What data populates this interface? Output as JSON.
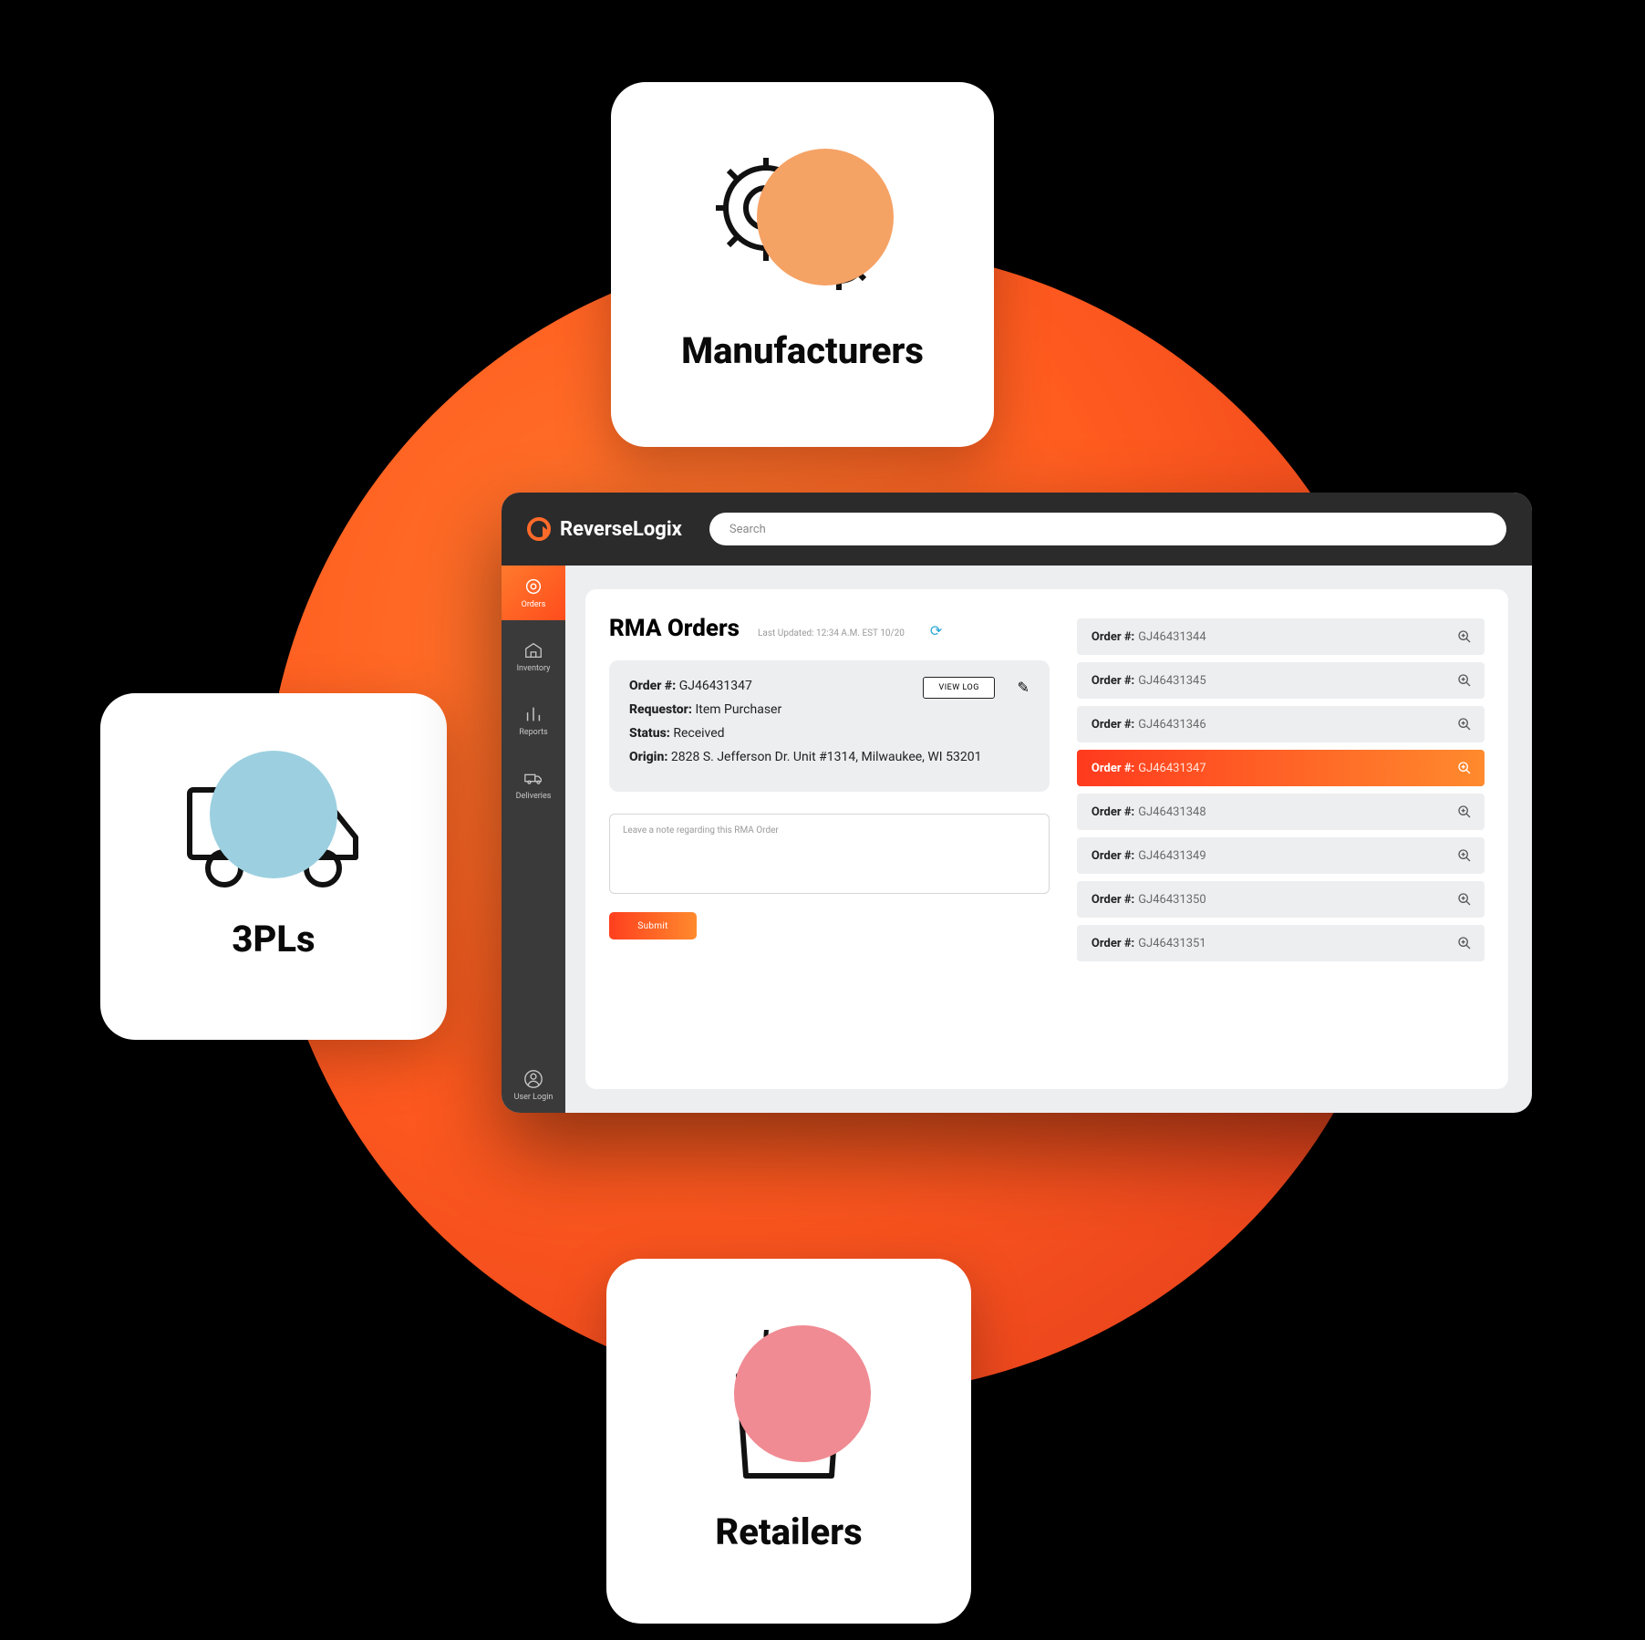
{
  "cards": {
    "top": {
      "label": "Manufacturers"
    },
    "left": {
      "label": "3PLs"
    },
    "bottom": {
      "label": "Retailers"
    }
  },
  "app": {
    "brand": "ReverseLogix",
    "search_placeholder": "Search",
    "sidebar": [
      {
        "key": "orders",
        "label": "Orders",
        "active": true
      },
      {
        "key": "inventory",
        "label": "Inventory"
      },
      {
        "key": "reports",
        "label": "Reports"
      },
      {
        "key": "deliveries",
        "label": "Deliveries"
      }
    ],
    "user_login": "User Login",
    "page": {
      "title": "RMA Orders",
      "last_updated": "Last Updated: 12:34 A.M. EST 10/20",
      "detail": {
        "order_label": "Order #:",
        "order": "GJ46431347",
        "requestor_label": "Requestor:",
        "requestor": "Item Purchaser",
        "status_label": "Status:",
        "status": "Received",
        "origin_label": "Origin:",
        "origin": "2828 S. Jefferson Dr. Unit #1314, Milwaukee, WI 53201",
        "view_log": "VIEW LOG",
        "note_placeholder": "Leave a note regarding this RMA Order",
        "submit": "Submit"
      },
      "orders": [
        {
          "label": "Order #:",
          "num": "GJ46431344"
        },
        {
          "label": "Order #:",
          "num": "GJ46431345"
        },
        {
          "label": "Order #:",
          "num": "GJ46431346"
        },
        {
          "label": "Order #:",
          "num": "GJ46431347",
          "selected": true
        },
        {
          "label": "Order #:",
          "num": "GJ46431348"
        },
        {
          "label": "Order #:",
          "num": "GJ46431349"
        },
        {
          "label": "Order #:",
          "num": "GJ46431350"
        },
        {
          "label": "Order #:",
          "num": "GJ46431351"
        }
      ]
    }
  }
}
